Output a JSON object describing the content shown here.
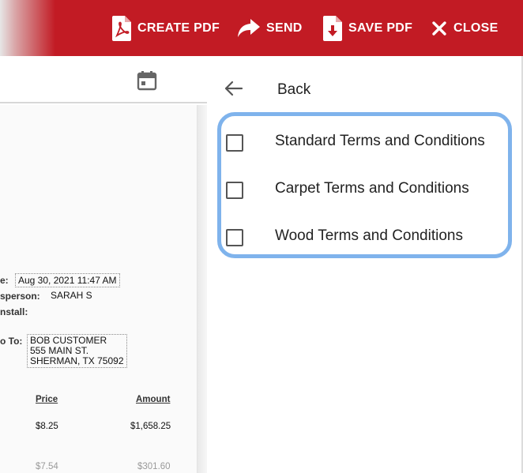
{
  "toolbar": {
    "create_pdf": "CREATE PDF",
    "send": "SEND",
    "save_pdf": "SAVE PDF",
    "close": "CLOSE",
    "background_color": "#c21b24"
  },
  "left_panel": {
    "toolbar_icon": "calendar-icon",
    "document": {
      "date_label": "e:",
      "date_value": "Aug 30, 2021 11:47 AM",
      "salesperson_label": "sperson:",
      "salesperson_value": "SARAH S",
      "install_label": "nstall:",
      "ship_to_label": "o To:",
      "ship_to_lines": [
        "BOB CUSTOMER",
        "555 MAIN ST.",
        "SHERMAN, TX 75092"
      ],
      "columns": {
        "price": "Price",
        "amount": "Amount"
      },
      "rows": [
        {
          "price": "$8.25",
          "amount": "$1,658.25"
        },
        {
          "price": "$7.54",
          "amount": "$301.60"
        }
      ]
    }
  },
  "right_panel": {
    "back_label": "Back",
    "terms": [
      {
        "label": "Standard Terms and Conditions",
        "checked": false
      },
      {
        "label": "Carpet Terms and Conditions",
        "checked": false
      },
      {
        "label": "Wood Terms and Conditions",
        "checked": false
      }
    ],
    "highlight_color": "#7fb3ec"
  }
}
